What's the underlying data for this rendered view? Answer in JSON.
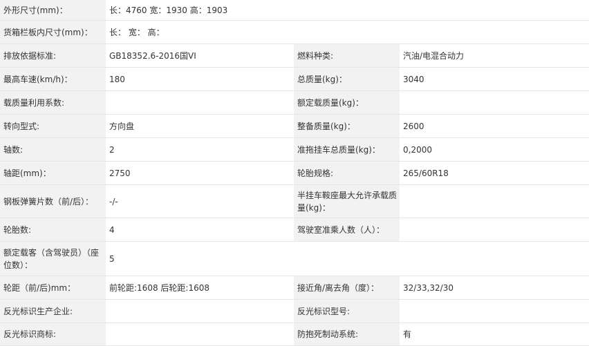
{
  "rows": [
    {
      "l1": "外形尺寸(mm)：",
      "v1": "长：4760 宽：1930 高：1903"
    },
    {
      "l1": "货箱栏板内尺寸(mm)：",
      "v1": "长： 宽： 高："
    },
    {
      "l1": "排放依据标准:",
      "v1": "GB18352.6-2016国VI",
      "l2": "燃料种类:",
      "v2": "汽油/电混合动力"
    },
    {
      "l1": "最高车速(km/h)：",
      "v1": "180",
      "l2": "总质量(kg)：",
      "v2": "3040"
    },
    {
      "l1": "载质量利用系数:",
      "v1": "",
      "l2": "额定载质量(kg)：",
      "v2": ""
    },
    {
      "l1": "转向型式:",
      "v1": "方向盘",
      "l2": "整备质量(kg)：",
      "v2": "2600"
    },
    {
      "l1": "轴数:",
      "v1": "2",
      "l2": "准拖挂车总质量(kg)：",
      "v2": "0,2000"
    },
    {
      "l1": "轴距(mm)：",
      "v1": "2750",
      "l2": "轮胎规格:",
      "v2": "265/60R18"
    },
    {
      "l1": "钢板弹簧片数（前/后）：",
      "v1": "-/-",
      "l2": "半挂车鞍座最大允许承载质量(kg)：",
      "v2": ""
    },
    {
      "l1": "轮胎数:",
      "v1": "4",
      "l2": "驾驶室准乘人数（人）：",
      "v2": ""
    },
    {
      "l1": "额定载客（含驾驶员）（座位数）：",
      "v1": "5"
    },
    {
      "l1": "轮距（前/后)mm：",
      "v1": "前轮距:1608 后轮距:1608",
      "l2": "接近角/离去角（度）：",
      "v2": "32/33,32/30"
    },
    {
      "l1": "反光标识生产企业:",
      "v1": "",
      "l2": "反光标识型号:",
      "v2": ""
    },
    {
      "l1": "反光标识商标:",
      "v1": "",
      "l2": "防抱死制动系统:",
      "v2": "有"
    }
  ]
}
